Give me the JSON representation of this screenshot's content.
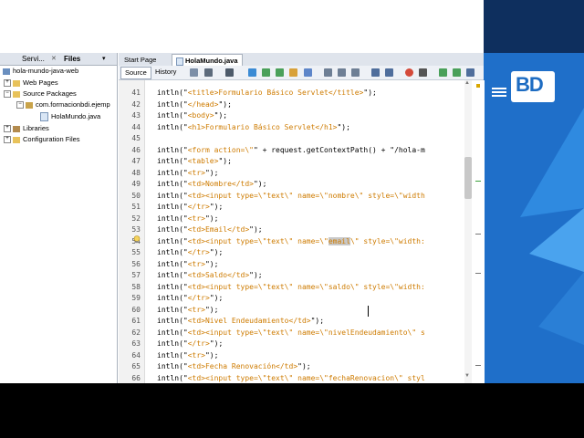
{
  "left_panel": {
    "tabs": [
      "Servi...",
      "Files"
    ],
    "tree": [
      {
        "label": "hola-mundo-java-web",
        "level": 0
      },
      {
        "label": "Web Pages",
        "level": 1
      },
      {
        "label": "Source Packages",
        "level": 1
      },
      {
        "label": "com.formacionbdi.ejemp",
        "level": 2
      },
      {
        "label": "HolaMundo.java",
        "level": 3
      },
      {
        "label": "Libraries",
        "level": 1
      },
      {
        "label": "Configuration Files",
        "level": 1
      }
    ]
  },
  "editor": {
    "tabs": [
      "Start Page",
      "HolaMundo.java"
    ],
    "toolbar": {
      "source": "Source",
      "history": "History"
    },
    "line_numbers": [
      "41",
      "42",
      "43",
      "44",
      "45",
      "46",
      "47",
      "48",
      "49",
      "50",
      "51",
      "52",
      "53",
      "54",
      "55",
      "56",
      "57",
      "58",
      "59",
      "60",
      "61",
      "62",
      "63",
      "64",
      "65",
      "66"
    ],
    "lines": [
      {
        "pre": "intln(\"",
        "str": "<title>Formulario Básico Servlet</title>",
        "post": "\");"
      },
      {
        "pre": "intln(\"",
        "str": "</head>",
        "post": "\");"
      },
      {
        "pre": "intln(\"",
        "str": "<body>",
        "post": "\");"
      },
      {
        "pre": "intln(\"",
        "str": "<h1>Formulario Básico Servlet</h1>",
        "post": "\");"
      },
      {
        "pre": "",
        "str": "",
        "post": ""
      },
      {
        "pre": "intln(\"",
        "str": "<form action=\\\"",
        "post": "\" + request.getContextPath() + \"/hola-m"
      },
      {
        "pre": "intln(\"",
        "str": "<table>",
        "post": "\");"
      },
      {
        "pre": "intln(\"",
        "str": "<tr>",
        "post": "\");"
      },
      {
        "pre": "intln(\"",
        "str": "<td>Nombre</td>",
        "post": "\");"
      },
      {
        "pre": "intln(\"",
        "str": "<td><input type=\\\"text\\\" name=\\\"nombre\\\" style=\\\"width",
        "post": ""
      },
      {
        "pre": "intln(\"",
        "str": "</tr>",
        "post": "\");"
      },
      {
        "pre": "intln(\"",
        "str": "<tr>",
        "post": "\");"
      },
      {
        "pre": "intln(\"",
        "str": "<td>Email</td>",
        "post": "\");"
      },
      {
        "pre": "intln(\"",
        "str": "<td><input type=\\\"text\\\" name=\\\"",
        "hl": "email",
        "str2": "\\\" style=\\\"width:",
        "post": ""
      },
      {
        "pre": "intln(\"",
        "str": "</tr>",
        "post": "\");"
      },
      {
        "pre": "intln(\"",
        "str": "<tr>",
        "post": "\");"
      },
      {
        "pre": "intln(\"",
        "str": "<td>Saldo</td>",
        "post": "\");"
      },
      {
        "pre": "intln(\"",
        "str": "<td><input type=\\\"text\\\" name=\\\"saldo\\\" style=\\\"width:",
        "post": ""
      },
      {
        "pre": "intln(\"",
        "str": "</tr>",
        "post": "\");"
      },
      {
        "pre": "intln(\"",
        "str": "<tr>",
        "post": "\");"
      },
      {
        "pre": "intln(\"",
        "str": "<td>Nivel Endeudamiento</td>",
        "post": "\");"
      },
      {
        "pre": "intln(\"",
        "str": "<td><input type=\\\"text\\\" name=\\\"nivelEndeudamiento\\\" s",
        "post": ""
      },
      {
        "pre": "intln(\"",
        "str": "</tr>",
        "post": "\");"
      },
      {
        "pre": "intln(\"",
        "str": "<tr>",
        "post": "\");"
      },
      {
        "pre": "intln(\"",
        "str": "<td>Fecha Renovación</td>",
        "post": "\");"
      },
      {
        "pre": "intln(\"",
        "str": "<td><input type=\\\"text\\\" name=\\\"fechaRenovacion\\\" styl",
        "post": ""
      }
    ]
  },
  "logo": {
    "text": "BD"
  },
  "colors": {
    "string": "#ce7b00",
    "desktop": "#1f6fc9"
  }
}
